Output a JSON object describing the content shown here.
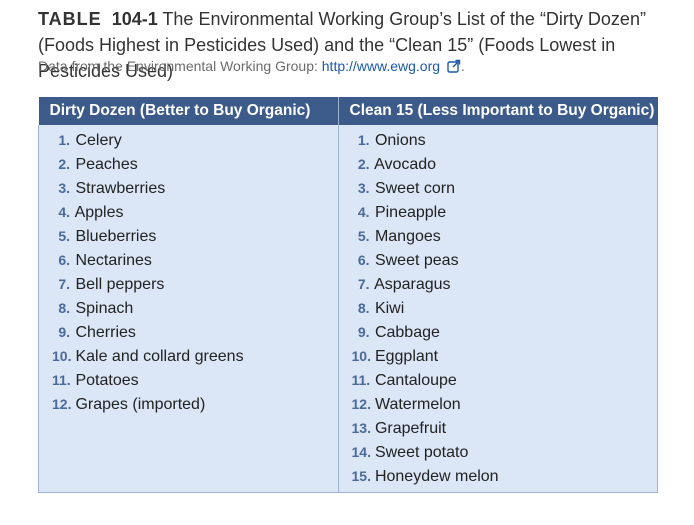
{
  "caption": {
    "label": "TABLE",
    "number": "104-1",
    "text": "The Environmental Working Group’s List of the “Dirty Dozen” (Foods Highest in Pesticides Used) and the “Clean 15” (Foods Lowest in Pesticides Used)"
  },
  "source": {
    "text": "Data from the Environmental Working Group:",
    "link_text": "http://www.ewg.org",
    "icon": "external-link-icon",
    "trailing": "."
  },
  "table": {
    "headers": [
      "Dirty Dozen (Better to Buy Organic)",
      "Clean 15 (Less Important to Buy Organic)"
    ],
    "dirty_dozen": [
      {
        "num": "1.",
        "item": "Celery"
      },
      {
        "num": "2.",
        "item": "Peaches"
      },
      {
        "num": "3.",
        "item": "Strawberries"
      },
      {
        "num": "4.",
        "item": "Apples"
      },
      {
        "num": "5.",
        "item": "Blueberries"
      },
      {
        "num": "6.",
        "item": "Nectarines"
      },
      {
        "num": "7.",
        "item": "Bell peppers"
      },
      {
        "num": "8.",
        "item": "Spinach"
      },
      {
        "num": "9.",
        "item": "Cherries"
      },
      {
        "num": "10.",
        "item": "Kale and collard greens"
      },
      {
        "num": "11.",
        "item": "Potatoes"
      },
      {
        "num": "12.",
        "item": "Grapes (imported)"
      }
    ],
    "clean_15": [
      {
        "num": "1.",
        "item": "Onions"
      },
      {
        "num": "2.",
        "item": "Avocado"
      },
      {
        "num": "3.",
        "item": "Sweet corn"
      },
      {
        "num": "4.",
        "item": "Pineapple"
      },
      {
        "num": "5.",
        "item": "Mangoes"
      },
      {
        "num": "6.",
        "item": "Sweet peas"
      },
      {
        "num": "7.",
        "item": "Asparagus"
      },
      {
        "num": "8.",
        "item": "Kiwi"
      },
      {
        "num": "9.",
        "item": "Cabbage"
      },
      {
        "num": "10.",
        "item": "Eggplant"
      },
      {
        "num": "11.",
        "item": "Cantaloupe"
      },
      {
        "num": "12.",
        "item": "Watermelon"
      },
      {
        "num": "13.",
        "item": "Grapefruit"
      },
      {
        "num": "14.",
        "item": "Sweet potato"
      },
      {
        "num": "15.",
        "item": "Honeydew melon"
      }
    ]
  },
  "colors": {
    "header_bg": "#3d5b8a",
    "cell_bg": "#dbe6f6",
    "number_color": "#4a6a9a",
    "link_color": "#1a5aa8"
  }
}
